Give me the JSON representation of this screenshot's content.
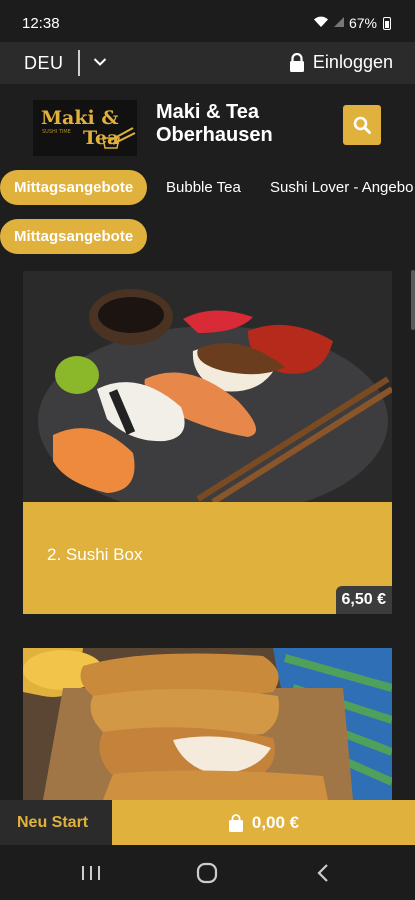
{
  "status_bar": {
    "time": "12:38",
    "battery": "67%",
    "icons": [
      "wifi-icon",
      "signal-icon",
      "battery-icon"
    ]
  },
  "top_bar": {
    "language": "DEU",
    "login_label": "Einloggen"
  },
  "header": {
    "logo_text": "Maki & Tea",
    "logo_subtext": "SUSHI TIME",
    "shop_name_line1": "Maki & Tea",
    "shop_name_line2": "Oberhausen"
  },
  "category_tabs": [
    {
      "label": "Mittagsangebote",
      "active": true
    },
    {
      "label": "Bubble Tea",
      "active": false
    },
    {
      "label": "Sushi Lover - Angebo",
      "active": false
    }
  ],
  "subcategory": {
    "label": "Mittagsangebote"
  },
  "products": [
    {
      "title": "2. Sushi Box",
      "price": "6,50 €",
      "image": "sushi-platter"
    },
    {
      "title": "",
      "price": "",
      "image": "fried-chicken"
    }
  ],
  "bottom_bar": {
    "new_start_label": "Neu Start",
    "cart_total": "0,00 €"
  },
  "colors": {
    "accent": "#e0b13c",
    "background": "#1e1e1e",
    "bar": "#2b2b2b",
    "price_badge": "#3c3c3c"
  }
}
